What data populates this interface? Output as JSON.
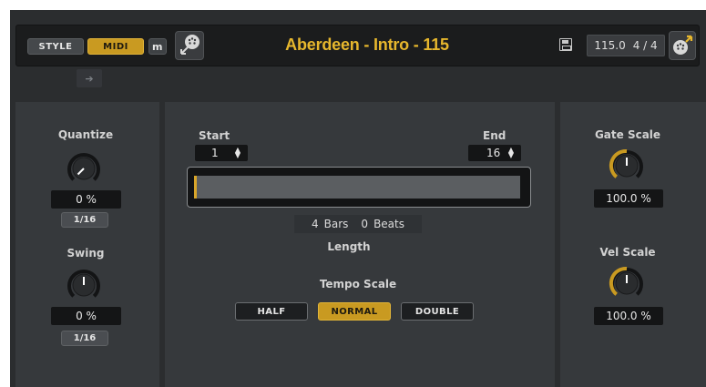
{
  "header": {
    "style_label": "STYLE",
    "midi_label": "MIDI",
    "m_label": "m",
    "title": "Aberdeen - Intro - 115",
    "tempo": "115.0",
    "signature": "4 / 4"
  },
  "arrow_glyph": "➔",
  "left": {
    "quantize": {
      "label": "Quantize",
      "value": "0 %",
      "resolution": "1/16",
      "level": 0
    },
    "swing": {
      "label": "Swing",
      "value": "0 %",
      "resolution": "1/16",
      "level": 0.5
    }
  },
  "middle": {
    "start_label": "Start",
    "start_value": "1",
    "end_label": "End",
    "end_value": "16",
    "bars_value": "4",
    "bars_unit": "Bars",
    "beats_value": "0",
    "beats_unit": "Beats",
    "length_label": "Length",
    "tempo_scale_label": "Tempo Scale",
    "tempo_buttons": [
      {
        "label": "HALF",
        "active": false
      },
      {
        "label": "NORMAL",
        "active": true
      },
      {
        "label": "DOUBLE",
        "active": false
      }
    ]
  },
  "right": {
    "gate_scale": {
      "label": "Gate Scale",
      "value": "100.0 %",
      "level": 0.5
    },
    "vel_scale": {
      "label": "Vel Scale",
      "value": "100.0 %",
      "level": 0.5
    }
  },
  "colors": {
    "accent": "#c99a21",
    "title": "#e7b72d",
    "panel": "#36393c",
    "background": "#2b2d2f"
  },
  "icons": [
    "midi-port-icon",
    "save-icon",
    "sync-icon",
    "arrow-right-icon",
    "spin-arrows-icon"
  ]
}
